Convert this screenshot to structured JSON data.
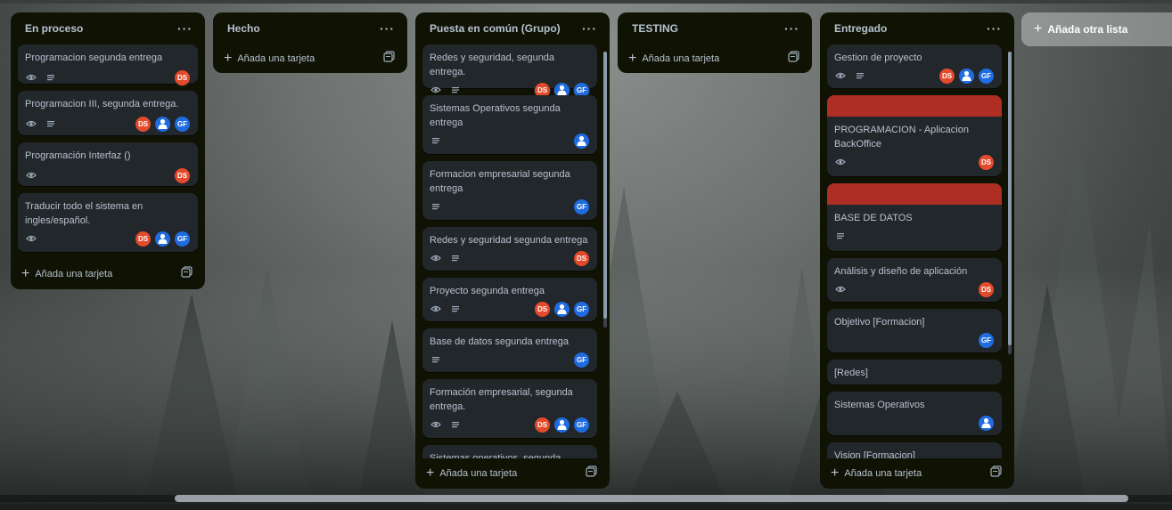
{
  "lists": [
    {
      "id": "en-proceso",
      "title": "En proceso",
      "add_label": "Añada una tarjeta",
      "cards": [
        {
          "title": "Programacion segunda entrega",
          "watch": true,
          "desc": true,
          "members": [
            "DS"
          ]
        },
        {
          "title": "Programacion III, segunda entrega.",
          "watch": true,
          "desc": true,
          "members": [
            "DS",
            "user",
            "GF"
          ]
        },
        {
          "title": "Programación Interfaz ()",
          "watch": true,
          "desc": false,
          "members": [
            "DS"
          ]
        },
        {
          "title": "Traducir todo el sistema en ingles/español.",
          "watch": true,
          "desc": false,
          "members": [
            "DS",
            "user",
            "GF"
          ]
        }
      ]
    },
    {
      "id": "hecho",
      "title": "Hecho",
      "add_label": "Añada una tarjeta",
      "cards": []
    },
    {
      "id": "puesta-en-comun",
      "title": "Puesta en común (Grupo)",
      "add_label": "Añada una tarjeta",
      "cards": [
        {
          "title": "Redes y seguridad, segunda entrega.",
          "watch": true,
          "desc": true,
          "members": [
            "DS",
            "user",
            "GF"
          ]
        },
        {
          "title": "Sistemas Operativos segunda entrega",
          "watch": false,
          "desc": true,
          "members": [
            "user"
          ]
        },
        {
          "title": "Formacion empresarial segunda entrega",
          "watch": false,
          "desc": true,
          "members": [
            "GF"
          ]
        },
        {
          "title": "Redes y seguridad segunda entrega",
          "watch": true,
          "desc": true,
          "members": [
            "DS"
          ]
        },
        {
          "title": "Proyecto segunda entrega",
          "watch": true,
          "desc": true,
          "members": [
            "DS",
            "user",
            "GF"
          ]
        },
        {
          "title": "Base de datos segunda entrega",
          "watch": false,
          "desc": true,
          "members": [
            "GF"
          ]
        },
        {
          "title": "Formación empresarial, segunda entrega.",
          "watch": true,
          "desc": true,
          "members": [
            "DS",
            "user",
            "GF"
          ]
        },
        {
          "title": "Sistemas operativos, segunda",
          "watch": false,
          "desc": false,
          "members": []
        }
      ]
    },
    {
      "id": "testing",
      "title": "TESTING",
      "add_label": "Añada una tarjeta",
      "cards": []
    },
    {
      "id": "entregado",
      "title": "Entregado",
      "add_label": "Añada una tarjeta",
      "cards": [
        {
          "title": "Gestion de proyecto",
          "watch": true,
          "desc": true,
          "members": [
            "DS",
            "user",
            "GF"
          ]
        },
        {
          "title": "PROGRAMACION - Aplicacion BackOffice",
          "cover": "#ae2e24",
          "watch": true,
          "desc": false,
          "members": [
            "DS"
          ]
        },
        {
          "title": "BASE DE DATOS",
          "cover": "#ae2e24",
          "watch": false,
          "desc": true,
          "members": []
        },
        {
          "title": "Análisis y diseño de aplicación",
          "watch": true,
          "desc": false,
          "members": [
            "DS"
          ]
        },
        {
          "title": "Objetivo [Formacion]",
          "watch": false,
          "desc": false,
          "members": [
            "GF"
          ]
        },
        {
          "title": "[Redes]",
          "watch": false,
          "desc": false,
          "members": []
        },
        {
          "title": "Sistemas Operativos",
          "watch": false,
          "desc": false,
          "members": [
            "user"
          ]
        },
        {
          "title": "Vision [Formacion]",
          "watch": false,
          "desc": false,
          "members": []
        }
      ]
    }
  ],
  "add_list_label": "Añada otra lista",
  "colors": {
    "ds": "#e34a2b",
    "gf": "#1f6be0",
    "list_bg": "#101204",
    "card_bg": "#22272b",
    "cover_red": "#ae2e24"
  },
  "icons": {
    "watch": "eye-icon",
    "description": "description-icon",
    "more": "more-icon",
    "add": "plus-icon",
    "template": "template-icon",
    "member": "user-avatar-icon"
  }
}
